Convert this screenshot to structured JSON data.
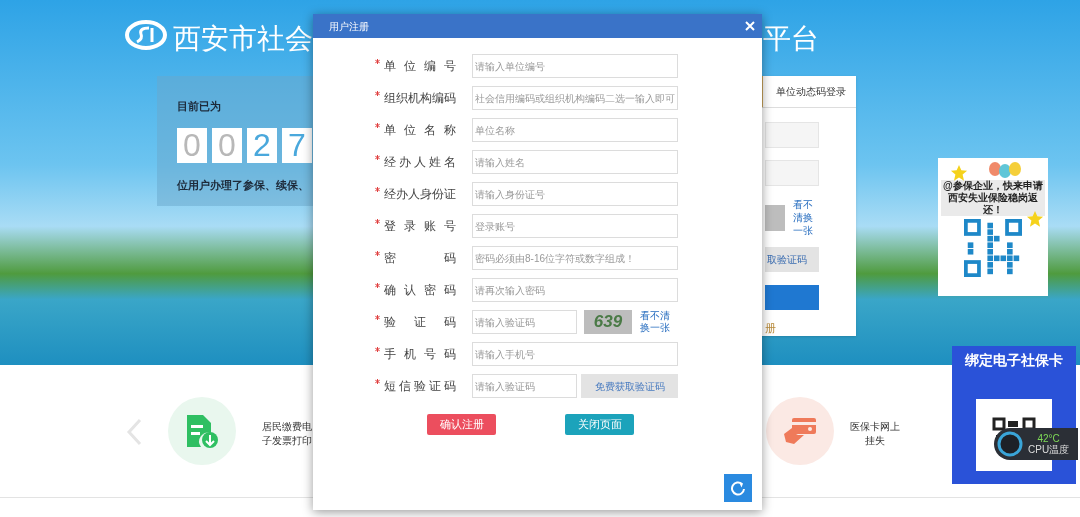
{
  "header": {
    "title_left": "西安市社会",
    "title_right": "平台"
  },
  "counter": {
    "caption": "目前已为",
    "digits": [
      "0",
      "0",
      "2",
      "7"
    ],
    "text": "位用户办理了参保、续保、"
  },
  "login_panel": {
    "tab": "单位动态码登录",
    "captcha_link": "看不清换一张",
    "sms_button": "取验证码",
    "register_link": "册"
  },
  "qr_poster": {
    "text": "@参保企业，快来申请西安失业保险稳岗返还！"
  },
  "ad_banner": {
    "title": "绑定电子社保卡"
  },
  "cpu_widget": {
    "temperature": "42°C",
    "label": "CPU温度"
  },
  "services": [
    {
      "kind": "invoice",
      "label": "居民缴费电子发票打印"
    },
    {
      "kind": "card",
      "label": "医保卡网上挂失"
    }
  ],
  "dialog": {
    "title": "用户注册",
    "fields": [
      {
        "kind": "text",
        "label": "单位编号",
        "required": true,
        "placeholder": "请输入单位编号"
      },
      {
        "kind": "text",
        "label": "组织机构编码",
        "required": true,
        "placeholder": "社会信用编码或组织机构编码二选一输入即可"
      },
      {
        "kind": "text",
        "label": "单位名称",
        "required": true,
        "placeholder": "单位名称"
      },
      {
        "kind": "text",
        "label": "经办人姓名",
        "required": true,
        "placeholder": "请输入姓名"
      },
      {
        "kind": "text",
        "label": "经办人身份证",
        "required": true,
        "placeholder": "请输入身份证号"
      },
      {
        "kind": "text",
        "label": "登录账号",
        "required": true,
        "placeholder": "登录账号"
      },
      {
        "kind": "text",
        "label": "密码",
        "required": true,
        "placeholder": "密码必须由8-16位字符或数字组成！"
      },
      {
        "kind": "text",
        "label": "确认密码",
        "required": true,
        "placeholder": "请再次输入密码"
      },
      {
        "kind": "captcha",
        "label": "验证码",
        "required": true,
        "placeholder": "请输入验证码",
        "captcha": "639",
        "link": "看不清换一张"
      },
      {
        "kind": "text",
        "label": "手机号码",
        "required": true,
        "placeholder": "请输入手机号"
      },
      {
        "kind": "sms",
        "label": "短信验证码",
        "required": true,
        "placeholder": "请输入验证码",
        "button": "免费获取验证码"
      }
    ],
    "buttons": [
      {
        "kind": "confirm",
        "label": "确认注册"
      },
      {
        "kind": "close",
        "label": "关闭页面"
      }
    ]
  }
}
